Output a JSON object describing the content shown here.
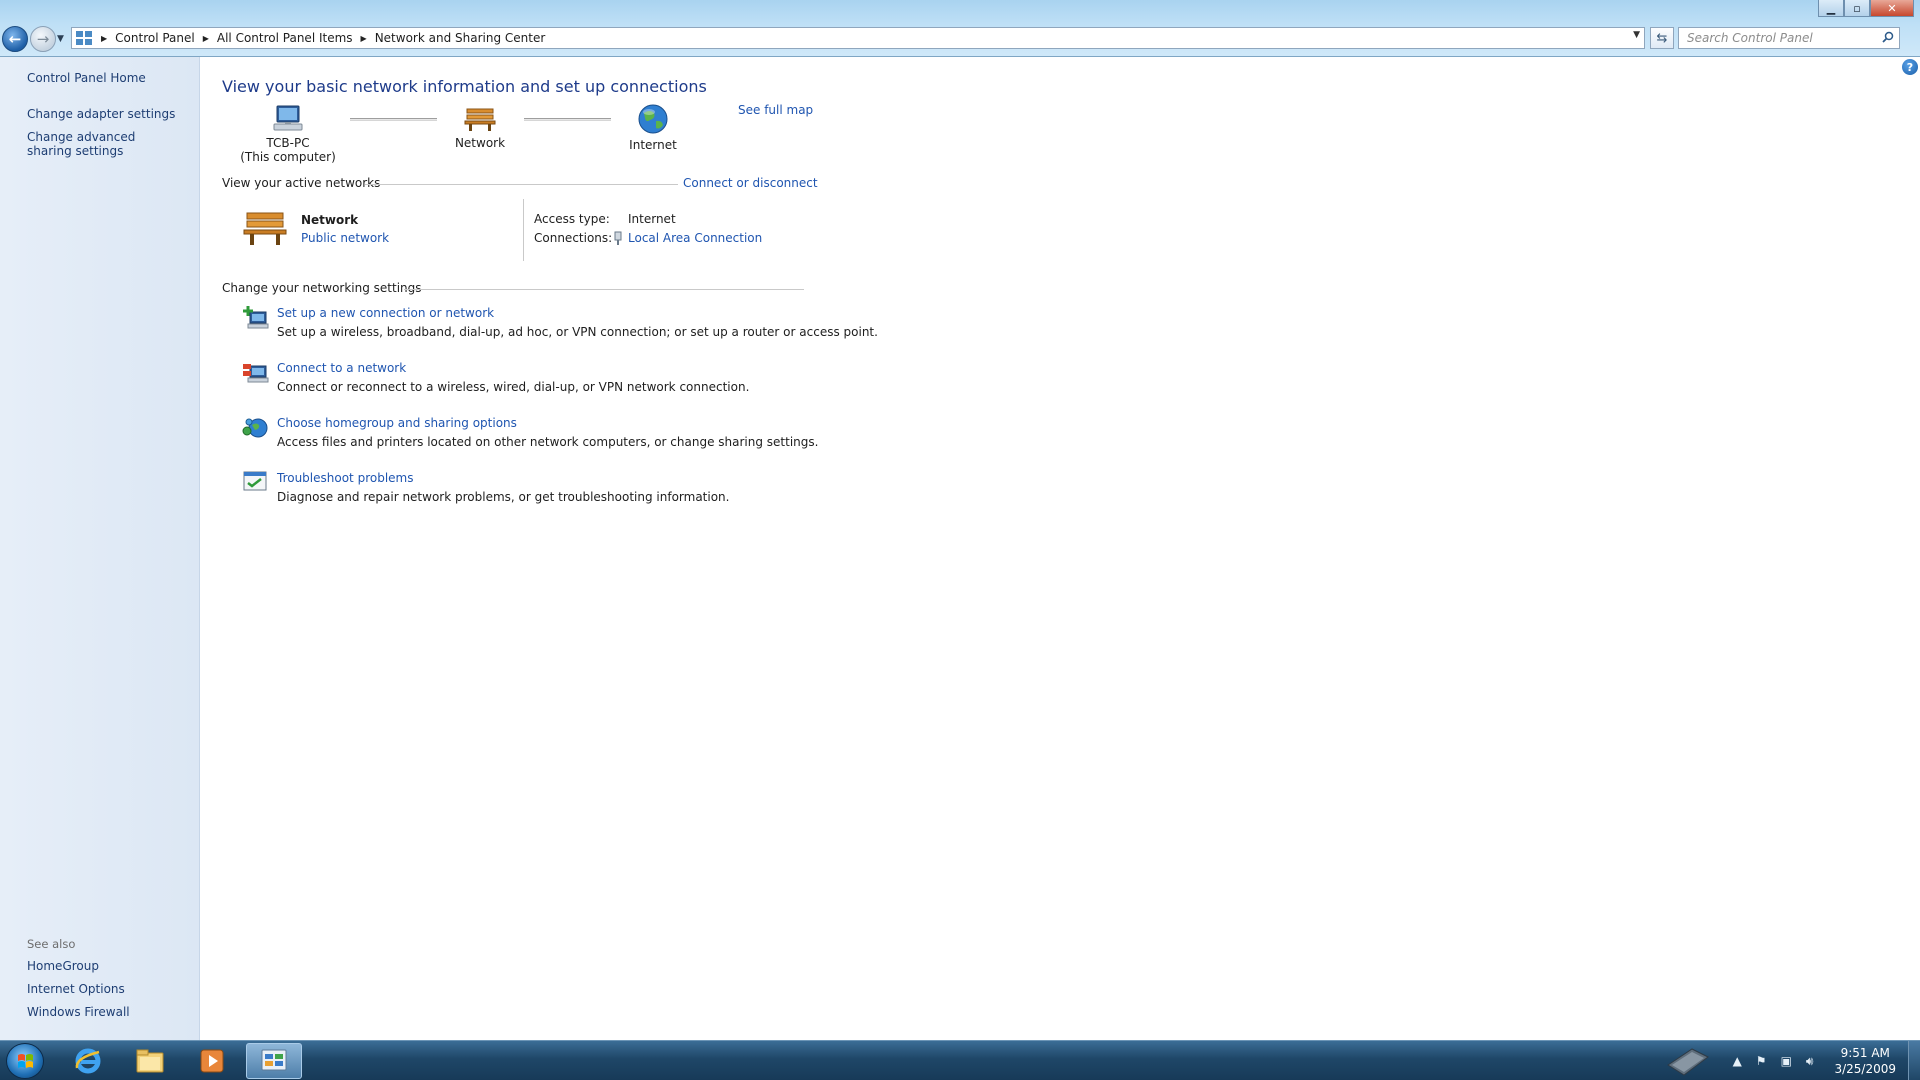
{
  "window": {
    "controls": {
      "minimize": "▁",
      "maximize": "▫",
      "close": "✕"
    }
  },
  "address": {
    "crumbs": [
      "Control Panel",
      "All Control Panel Items",
      "Network and Sharing Center"
    ],
    "search_placeholder": "Search Control Panel"
  },
  "left_pane": {
    "home": "Control Panel Home",
    "links": [
      "Change adapter settings",
      "Change advanced sharing settings"
    ],
    "see_also_heading": "See also",
    "see_also": [
      "HomeGroup",
      "Internet Options",
      "Windows Firewall"
    ]
  },
  "main": {
    "title": "View your basic network information and set up connections",
    "see_full_map": "See full map",
    "map": {
      "computer_name": "TCB-PC",
      "computer_sub": "(This computer)",
      "network": "Network",
      "internet": "Internet"
    },
    "active_networks": {
      "heading": "View your active networks",
      "connect_link": "Connect or disconnect",
      "network_name": "Network",
      "network_type": "Public network",
      "access_type_label": "Access type:",
      "access_type_value": "Internet",
      "connections_label": "Connections:",
      "connections_value": "Local Area Connection"
    },
    "settings": {
      "heading": "Change your networking settings",
      "tasks": [
        {
          "title": "Set up a new connection or network",
          "desc": "Set up a wireless, broadband, dial-up, ad hoc, or VPN connection; or set up a router or access point."
        },
        {
          "title": "Connect to a network",
          "desc": "Connect or reconnect to a wireless, wired, dial-up, or VPN network connection."
        },
        {
          "title": "Choose homegroup and sharing options",
          "desc": "Access files and printers located on other network computers, or change sharing settings."
        },
        {
          "title": "Troubleshoot problems",
          "desc": "Diagnose and repair network problems, or get troubleshooting information."
        }
      ]
    }
  },
  "taskbar": {
    "time": "9:51 AM",
    "date": "3/25/2009"
  }
}
